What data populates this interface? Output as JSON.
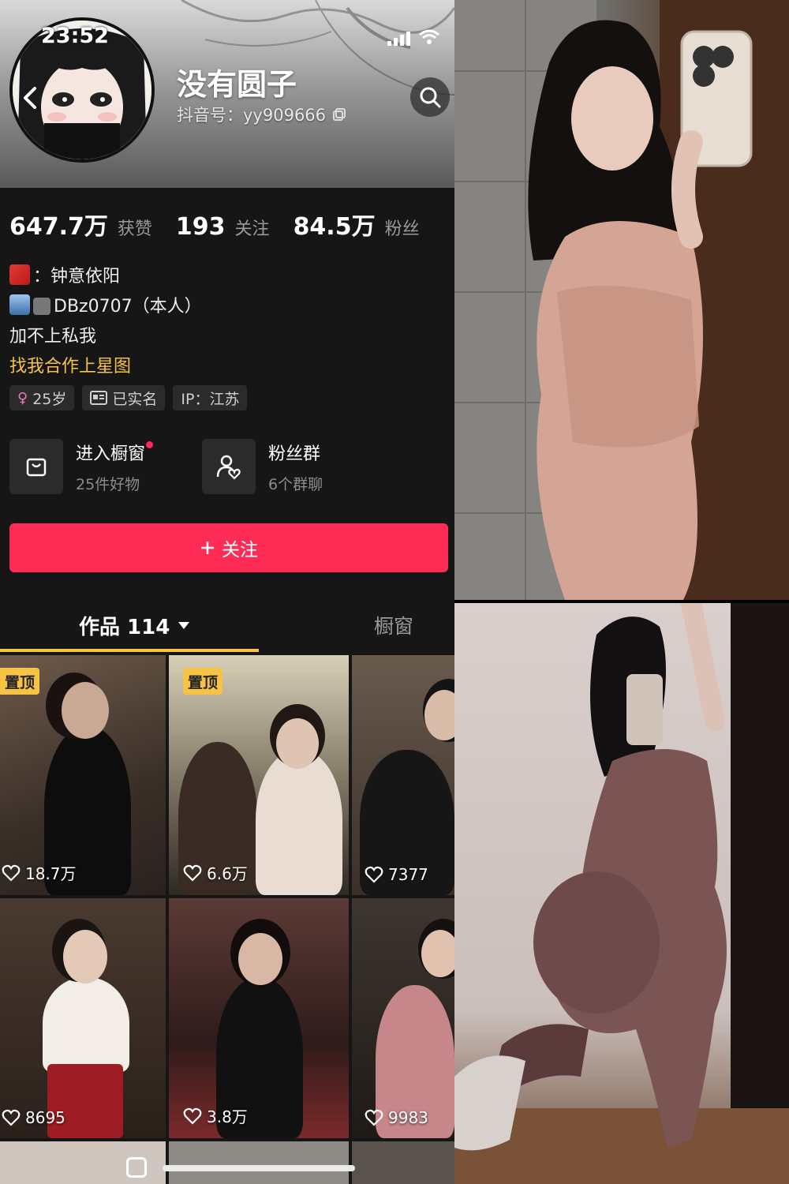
{
  "status_bar": {
    "time": "23:52"
  },
  "profile": {
    "name": "没有圆子",
    "douyin_id": "抖音号：yy909666"
  },
  "stats": [
    {
      "value": "647.7万",
      "label": "获赞"
    },
    {
      "value": "193",
      "label": "关注"
    },
    {
      "value": "84.5万",
      "label": "粉丝"
    }
  ],
  "bio": {
    "line1": "：钟意依阳",
    "line2": "DBz0707（本人）",
    "line3": "加不上私我",
    "star_link": "找我合作上星图"
  },
  "tags": [
    {
      "icon": "female-icon",
      "label": "25岁"
    },
    {
      "icon": "id-card-icon",
      "label": "已实名"
    },
    {
      "icon": "",
      "label": "IP：江苏"
    }
  ],
  "cards": {
    "shop": {
      "title": "进入橱窗",
      "subtitle": "25件好物"
    },
    "fans": {
      "title": "粉丝群",
      "subtitle": "6个群聊"
    }
  },
  "follow_button": {
    "label": "关注"
  },
  "tabs": {
    "works": "作品 114",
    "shop": "橱窗"
  },
  "videos": [
    {
      "pinned": "置顶",
      "likes": "18.7万"
    },
    {
      "pinned": "置顶",
      "likes": "6.6万"
    },
    {
      "pinned": "",
      "likes": "7377"
    },
    {
      "pinned": "",
      "likes": "8695"
    },
    {
      "pinned": "",
      "likes": "3.8万"
    },
    {
      "pinned": "",
      "likes": "9983"
    }
  ],
  "colors": {
    "accent": "#fe2c55",
    "pin": "#f6c344",
    "background": "#161616"
  }
}
